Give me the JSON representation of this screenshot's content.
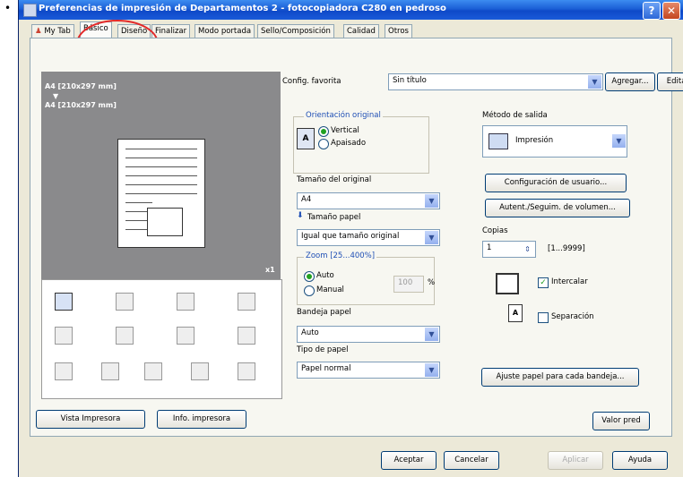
{
  "bullet": "•",
  "window": {
    "title": "Preferencias de impresión de Departamentos 2 - fotocopiadora C280 en pedroso",
    "help_symbol": "?",
    "close_symbol": "✕"
  },
  "tabs": [
    {
      "label": "My Tab"
    },
    {
      "label": "Básico",
      "active": true
    },
    {
      "label": "Diseño"
    },
    {
      "label": "Finalizar"
    },
    {
      "label": "Modo portada"
    },
    {
      "label": "Sello/Composición"
    },
    {
      "label": "Calidad"
    },
    {
      "label": "Otros"
    }
  ],
  "preview": {
    "line1": "A4 [210x297 mm]",
    "arrow": "▼",
    "line2": "A4 [210x297 mm]",
    "copies_mark": "x1"
  },
  "left_buttons": {
    "vista": "Vista Impresora",
    "info": "Info. impresora"
  },
  "favorite": {
    "label": "Config. favorita",
    "value": "Sin título",
    "add": "Agregar...",
    "edit": "Editar..."
  },
  "orientation": {
    "title": "Orientación original",
    "vertical": "Vertical",
    "apaisado": "Apaisado"
  },
  "original_size": {
    "label": "Tamaño del original",
    "value": "A4"
  },
  "paper_size": {
    "label": "Tamaño papel",
    "value": "Igual que tamaño original"
  },
  "zoom": {
    "title": "Zoom [25...400%]",
    "auto": "Auto",
    "manual": "Manual",
    "value": "100",
    "unit": "%"
  },
  "tray": {
    "label": "Bandeja papel",
    "value": "Auto"
  },
  "paper_type": {
    "label": "Tipo de papel",
    "value": "Papel normal"
  },
  "output": {
    "label": "Método de salida",
    "value": "Impresión",
    "config_user": "Configuración de usuario...",
    "auth": "Autent./Seguim. de volumen..."
  },
  "copies": {
    "label": "Copias",
    "value": "1",
    "range": "[1...9999]"
  },
  "collate": {
    "label": "Intercalar"
  },
  "separation": {
    "label": "Separación"
  },
  "tray_adjust": "Ajuste papel para cada bandeja...",
  "default_btn": "Valor pred",
  "dialog": {
    "accept": "Aceptar",
    "cancel": "Cancelar",
    "apply": "Aplicar",
    "help": "Ayuda"
  },
  "colors": {
    "titlebar": "#0e49c8",
    "annotation_circle": "#e22a2a",
    "dialog_bg": "#ece9d8"
  }
}
